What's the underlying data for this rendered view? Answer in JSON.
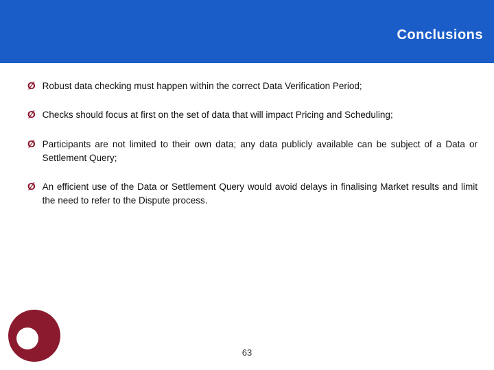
{
  "header": {
    "title": "Conclusions",
    "background_color": "#1a5bc8"
  },
  "bullets": [
    {
      "id": 1,
      "text": "Robust data checking must happen within the correct Data Verification Period;"
    },
    {
      "id": 2,
      "text": "Checks should focus at first on the set of data that will impact Pricing and Scheduling;"
    },
    {
      "id": 3,
      "text": "Participants are not limited to their own data; any data publicly available can be subject of a Data or Settlement Query;"
    },
    {
      "id": 4,
      "text": "An efficient use of the Data or Settlement Query would avoid delays in finalising Market results and limit the need to refer to the Dispute process."
    }
  ],
  "page_number": "63",
  "arrow_symbol": "Ø"
}
